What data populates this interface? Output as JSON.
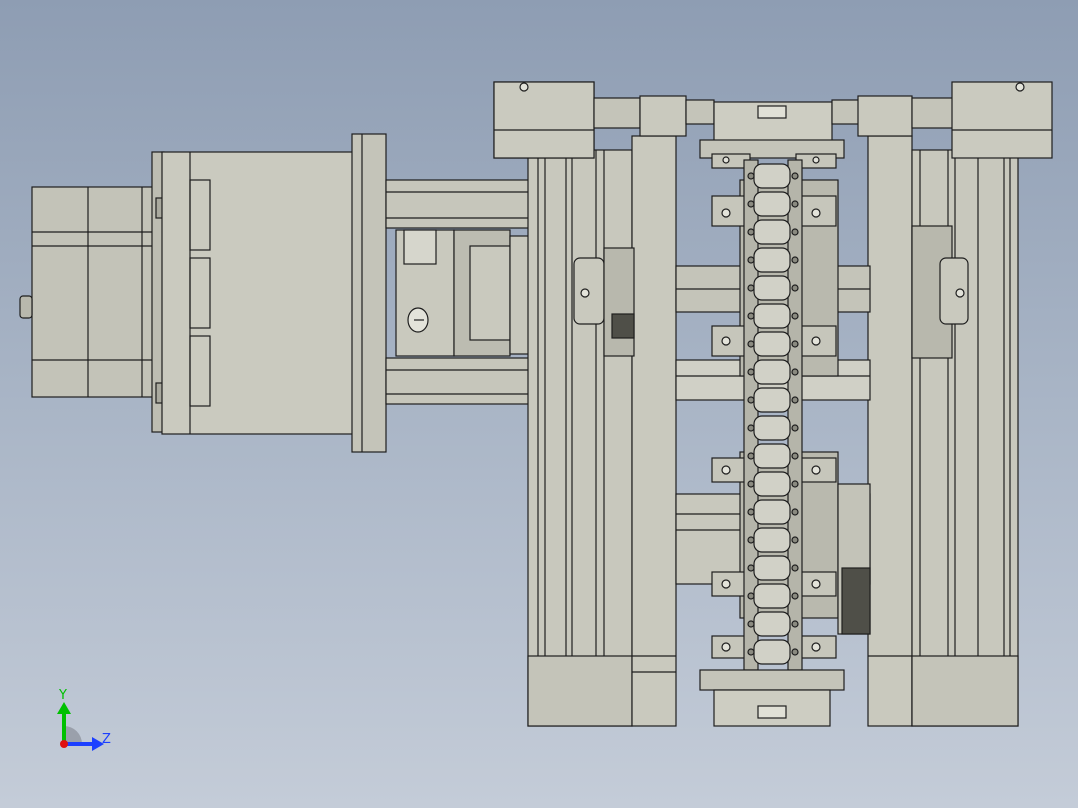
{
  "app": {
    "view": "CAD 3D viewport"
  },
  "colors": {
    "background_top": "#8e9db3",
    "background_bottom": "#c4ccd8",
    "part_fill": "#c9c9bf",
    "part_shade": "#a9a99e",
    "part_dark": "#6f6f66",
    "edge": "#1e1e1e",
    "axis_y": "#00c000",
    "axis_z": "#1c3fff",
    "axis_origin": "#e01010"
  },
  "triad": {
    "y_label": "Y",
    "z_label": "Z",
    "y_color": "#00c000",
    "z_color": "#1c3fff"
  },
  "model": {
    "components": [
      "stepper-motor",
      "gearbox",
      "motor-mount-plate",
      "jaw-coupling",
      "drive-shaft",
      "linear-rail-left",
      "linear-rail-right",
      "carriage-block",
      "roller-chain",
      "chain-attachment-brackets",
      "sprocket"
    ]
  }
}
